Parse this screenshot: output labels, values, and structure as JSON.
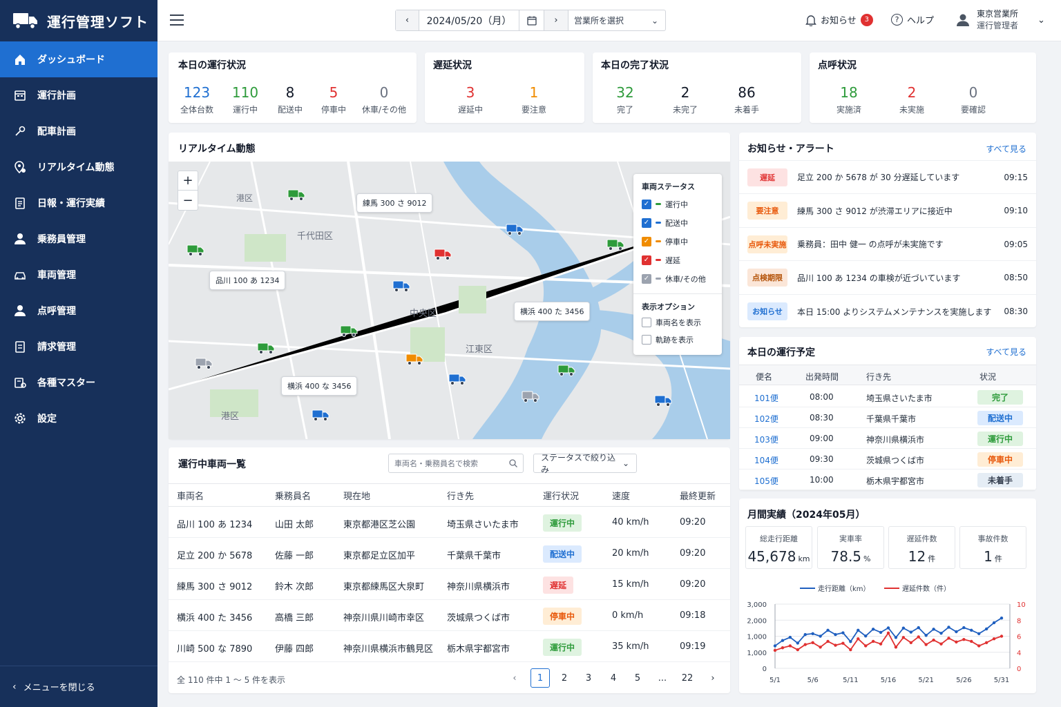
{
  "app": {
    "title": "運行管理ソフト"
  },
  "sidebar": {
    "items": [
      {
        "label": "ダッシュボード",
        "icon": "home-icon"
      },
      {
        "label": "運行計画",
        "icon": "calendar-icon"
      },
      {
        "label": "配車計画",
        "icon": "route-icon"
      },
      {
        "label": "リアルタイム動態",
        "icon": "location-icon"
      },
      {
        "label": "日報・運行実績",
        "icon": "report-icon"
      },
      {
        "label": "乗務員管理",
        "icon": "person-icon"
      },
      {
        "label": "車両管理",
        "icon": "car-icon"
      },
      {
        "label": "点呼管理",
        "icon": "person-check-icon"
      },
      {
        "label": "請求管理",
        "icon": "invoice-icon"
      },
      {
        "label": "各種マスター",
        "icon": "master-icon"
      },
      {
        "label": "設定",
        "icon": "gear-icon"
      }
    ],
    "close_label": "メニューを閉じる"
  },
  "topbar": {
    "date": "2024/05/20（月）",
    "office_placeholder": "営業所を選択",
    "notice_label": "お知らせ",
    "notice_count": "3",
    "help_label": "ヘルプ",
    "user_office": "東京営業所",
    "user_role": "運行管理者"
  },
  "summary": {
    "operation": {
      "title": "本日の運行状況",
      "stats": [
        {
          "value": "123",
          "label": "全体台数",
          "color": "#1f6fd1"
        },
        {
          "value": "110",
          "label": "運行中",
          "color": "#2e9b3b"
        },
        {
          "value": "8",
          "label": "配送中",
          "color": "#111827"
        },
        {
          "value": "5",
          "label": "停車中",
          "color": "#e03131"
        },
        {
          "value": "0",
          "label": "休車/その他",
          "color": "#6b7280"
        }
      ]
    },
    "delay": {
      "title": "遅延状況",
      "stats": [
        {
          "value": "3",
          "label": "遅延中",
          "color": "#e03131"
        },
        {
          "value": "1",
          "label": "要注意",
          "color": "#f08c00"
        }
      ]
    },
    "completion": {
      "title": "本日の完了状況",
      "stats": [
        {
          "value": "32",
          "label": "完了",
          "color": "#2e9b3b"
        },
        {
          "value": "2",
          "label": "未完了",
          "color": "#111827"
        },
        {
          "value": "86",
          "label": "未着手",
          "color": "#111827"
        }
      ]
    },
    "rollcall": {
      "title": "点呼状況",
      "stats": [
        {
          "value": "18",
          "label": "実施済",
          "color": "#2e9b3b"
        },
        {
          "value": "2",
          "label": "未実施",
          "color": "#e03131"
        },
        {
          "value": "0",
          "label": "要確認",
          "color": "#6b7280"
        }
      ]
    }
  },
  "map": {
    "title": "リアルタイム動態",
    "districts": [
      "港区",
      "千代田区",
      "中央区",
      "江東区",
      "港区"
    ],
    "plates": [
      "練馬 300 さ 9012",
      "品川 100 あ 1234",
      "横浜 400 た 3456",
      "横浜 400 な 3456"
    ],
    "legend_title": "車両ステータス",
    "legend": [
      {
        "label": "運行中",
        "color": "#2e9b3b",
        "box": "#1f6fd1"
      },
      {
        "label": "配送中",
        "color": "#1f6fd1",
        "box": "#1f6fd1"
      },
      {
        "label": "停車中",
        "color": "#f08c00",
        "box": "#f08c00"
      },
      {
        "label": "遅延",
        "color": "#e03131",
        "box": "#e03131"
      },
      {
        "label": "休車/その他",
        "color": "#9ca3af",
        "box": "#9ca3af"
      }
    ],
    "options_title": "表示オプション",
    "options": [
      "車両名を表示",
      "軌跡を表示"
    ]
  },
  "vehicles": {
    "title": "運行中車両一覧",
    "search_placeholder": "車両名・乗務員名で検索",
    "filter_label": "ステータスで絞り込み",
    "columns": [
      "車両名",
      "乗務員名",
      "現在地",
      "行き先",
      "運行状況",
      "速度",
      "最終更新"
    ],
    "rows": [
      [
        "品川 100 あ 1234",
        "山田 太郎",
        "東京都港区芝公園",
        "埼玉県さいたま市",
        "運行中",
        "40 km/h",
        "09:20"
      ],
      [
        "足立 200 か 5678",
        "佐藤 一郎",
        "東京都足立区加平",
        "千葉県千葉市",
        "配送中",
        "20 km/h",
        "09:20"
      ],
      [
        "練馬 300 さ 9012",
        "鈴木 次郎",
        "東京都練馬区大泉町",
        "神奈川県横浜市",
        "遅延",
        "15 km/h",
        "09:20"
      ],
      [
        "横浜 400 た 3456",
        "高橋 三郎",
        "神奈川県川崎市幸区",
        "茨城県つくば市",
        "停車中",
        "0 km/h",
        "09:18"
      ],
      [
        "川崎 500 な 7890",
        "伊藤 四郎",
        "神奈川県横浜市鶴見区",
        "栃木県宇都宮市",
        "運行中",
        "35 km/h",
        "09:19"
      ]
    ],
    "footer": "全 110 件中 1 〜 5 件を表示",
    "pages": [
      "1",
      "2",
      "3",
      "4",
      "5",
      "...",
      "22"
    ]
  },
  "status_colors": {
    "運行中": {
      "bg": "#dff3e0",
      "fg": "#2e9b3b"
    },
    "配送中": {
      "bg": "#dbeafe",
      "fg": "#1f6fd1"
    },
    "遅延": {
      "bg": "#fde2e2",
      "fg": "#e03131"
    },
    "停車中": {
      "bg": "#ffedd5",
      "fg": "#e8590c"
    },
    "完了": {
      "bg": "#dff3e0",
      "fg": "#2e9b3b"
    },
    "未着手": {
      "bg": "#e5edf5",
      "fg": "#374151"
    }
  },
  "alerts": {
    "title": "お知らせ・アラート",
    "see_all": "すべて見る",
    "items": [
      {
        "tag": "遅延",
        "bg": "#fde2e2",
        "fg": "#e03131",
        "message": "足立 200 か 5678 が 30 分遅延しています",
        "time": "09:15"
      },
      {
        "tag": "要注意",
        "bg": "#ffedd5",
        "fg": "#e8590c",
        "message": "練馬 300 さ 9012 が渋滞エリアに接近中",
        "time": "09:10"
      },
      {
        "tag": "点呼未実施",
        "bg": "#ffedd5",
        "fg": "#e8590c",
        "message": "乗務員：田中 健一 の点呼が未実施です",
        "time": "09:05"
      },
      {
        "tag": "点検期限",
        "bg": "#fbe6d8",
        "fg": "#b45309",
        "message": "品川 100 あ 1234 の車検が近づいています",
        "time": "08:50"
      },
      {
        "tag": "お知らせ",
        "bg": "#dbeafe",
        "fg": "#1f6fd1",
        "message": "本日 15:00 よりシステムメンテナンスを実施します",
        "time": "08:30"
      }
    ]
  },
  "schedule": {
    "title": "本日の運行予定",
    "see_all": "すべて見る",
    "columns": [
      "便名",
      "出発時間",
      "行き先",
      "状況"
    ],
    "rows": [
      [
        "101便",
        "08:00",
        "埼玉県さいたま市",
        "完了"
      ],
      [
        "102便",
        "08:30",
        "千葉県千葉市",
        "配送中"
      ],
      [
        "103便",
        "09:00",
        "神奈川県横浜市",
        "運行中"
      ],
      [
        "104便",
        "09:30",
        "茨城県つくば市",
        "停車中"
      ],
      [
        "105便",
        "10:00",
        "栃木県宇都宮市",
        "未着手"
      ]
    ]
  },
  "monthly": {
    "title": "月間実績（2024年05月）",
    "kpis": [
      {
        "label": "総走行距離",
        "value": "45,678",
        "unit": "km"
      },
      {
        "label": "実車率",
        "value": "78.5",
        "unit": "%"
      },
      {
        "label": "遅延件数",
        "value": "12",
        "unit": "件"
      },
      {
        "label": "事故件数",
        "value": "1",
        "unit": "件"
      }
    ]
  },
  "chart_data": {
    "type": "line",
    "x": [
      "5/1",
      "5/2",
      "5/3",
      "5/4",
      "5/5",
      "5/6",
      "5/7",
      "5/8",
      "5/9",
      "5/10",
      "5/11",
      "5/12",
      "5/13",
      "5/14",
      "5/15",
      "5/16",
      "5/17",
      "5/18",
      "5/19",
      "5/20",
      "5/21",
      "5/22",
      "5/23",
      "5/24",
      "5/25",
      "5/26",
      "5/27",
      "5/28",
      "5/29",
      "5/30",
      "5/31"
    ],
    "xticks": [
      "5/1",
      "5/6",
      "5/11",
      "5/16",
      "5/21",
      "5/26",
      "5/31"
    ],
    "yticks_left": [
      "0",
      "1,000",
      "1,000",
      "2,000",
      "3,000"
    ],
    "yticks_right": [
      "0",
      "4",
      "6",
      "8",
      "10"
    ],
    "ylim_left": [
      0,
      3000
    ],
    "ylim_right": [
      0,
      10
    ],
    "series": [
      {
        "name": "走行距離（km）",
        "axis": "left",
        "color": "#1f5fbf",
        "values": [
          1050,
          1300,
          1450,
          1180,
          1580,
          1620,
          1500,
          1780,
          1580,
          1660,
          1250,
          1780,
          1510,
          1830,
          1680,
          1890,
          1440,
          1880,
          1690,
          1900,
          1540,
          1830,
          1640,
          1920,
          1710,
          1900,
          1780,
          1620,
          1840,
          2130,
          2350
        ]
      },
      {
        "name": "遅延件数（件）",
        "axis": "right",
        "color": "#e03131",
        "values": [
          2.8,
          3.2,
          3.5,
          2.9,
          3.7,
          4.0,
          3.3,
          4.2,
          3.6,
          3.9,
          2.9,
          4.6,
          3.5,
          4.2,
          3.8,
          5.5,
          3.3,
          4.8,
          4.0,
          4.9,
          3.7,
          4.4,
          3.8,
          4.7,
          4.1,
          4.5,
          4.2,
          3.5,
          4.0,
          4.6,
          5.0
        ]
      }
    ]
  }
}
